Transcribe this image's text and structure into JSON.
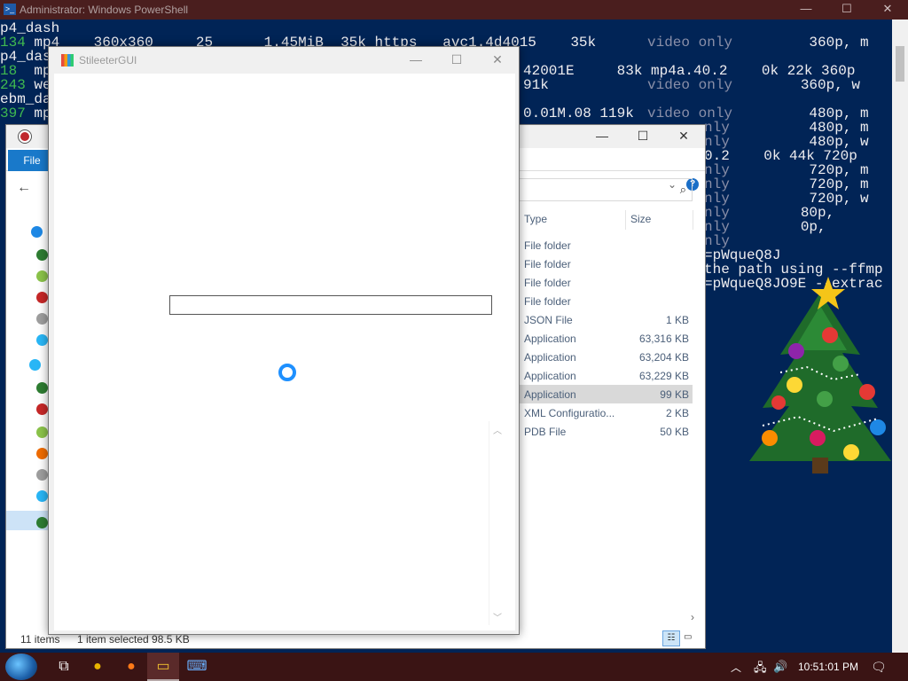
{
  "powershell": {
    "title": "Administrator: Windows PowerShell",
    "minimize": "—",
    "maximize": "☐",
    "close": "✕",
    "lines": [
      {
        "a": "p4_dash",
        "b": ""
      },
      {
        "a": "134",
        "b": " mp4    360x360     25      1.45MiB  35k https   avc1.4d4015    35k ",
        "c": "video only",
        "d": "         360p, m"
      },
      {
        "a": "p4_das",
        "b": ""
      },
      {
        "a": "18",
        "b": "  mp",
        "c2": "42001E     83k mp4a.40.2    0k 22k 360p"
      },
      {
        "a": "243",
        "b": " we",
        "c2": "91k ",
        "c": "video only",
        "d": "        360p, w"
      },
      {
        "a": "ebm_da",
        "b": ""
      },
      {
        "a": "397",
        "b": " mp",
        "c2": "0.01M.08 119k ",
        "c": "video only",
        "d": "         480p, m"
      },
      {
        "a": "",
        "b": "",
        "c2": "",
        "c": "nly",
        "d": "         480p, m"
      },
      {
        "a": "",
        "b": "",
        "c2": "",
        "c": "nly",
        "d": "         480p, w"
      },
      {
        "a": "",
        "b": "",
        "c2": "0.2    0k 44k 720p"
      },
      {
        "a": "",
        "b": "",
        "c2": "",
        "c": "nly",
        "d": "         720p, m"
      },
      {
        "a": "",
        "b": "",
        "c2": "",
        "c": "nly",
        "d": "         720p, m"
      },
      {
        "a": "",
        "b": "",
        "c2": "",
        "c": "nly",
        "d": "         720p, w"
      },
      {
        "a": "",
        "b": "",
        "c2": "",
        "c": "nly",
        "d": "        80p,"
      },
      {
        "a": "",
        "b": "",
        "c2": "",
        "c": "nly",
        "d": "        0p,"
      },
      {
        "a": "",
        "b": "",
        "c2": "",
        "c": "nly",
        "d": ""
      },
      {
        "a": "",
        "b": "",
        "c2": "=pWqueQ8J"
      },
      {
        "a": "",
        "b": "",
        "c2": "the path using --ffmp"
      },
      {
        "a": "",
        "b": "",
        "c2": "=pWqueQ8JO9E --extrac"
      }
    ]
  },
  "explorer": {
    "file_tab": "File",
    "back": "←",
    "search_icon": "⌕",
    "expand": "⌄",
    "help": "?",
    "minimize": "—",
    "maximize": "☐",
    "close": "✕",
    "columns": {
      "type": "Type",
      "size": "Size"
    },
    "rows": [
      {
        "type": "File folder",
        "size": ""
      },
      {
        "type": "File folder",
        "size": ""
      },
      {
        "type": "File folder",
        "size": ""
      },
      {
        "type": "File folder",
        "size": ""
      },
      {
        "type": "JSON File",
        "size": "1 KB"
      },
      {
        "type": "Application",
        "size": "63,316 KB"
      },
      {
        "type": "Application",
        "size": "63,204 KB"
      },
      {
        "type": "Application",
        "size": "63,229 KB"
      },
      {
        "type": "Application",
        "size": "99 KB",
        "selected": true
      },
      {
        "type": "XML Configuratio...",
        "size": "2 KB"
      },
      {
        "type": "PDB File",
        "size": "50 KB"
      }
    ],
    "status": {
      "items": "11 items",
      "selected": "1 item selected  98.5 KB"
    },
    "hscroll_arrow": "›",
    "view_details": "☷",
    "view_tiles": "▭"
  },
  "gui": {
    "title": "StileeterGUI",
    "minimize": "—",
    "maximize": "☐",
    "close": "✕",
    "input_value": "",
    "scroll_up": "︿",
    "scroll_down": "﹀"
  },
  "taskbar": {
    "taskview": "⧉",
    "chrome": "●",
    "firefox": "●",
    "explorer": "▭",
    "powershell": "⌨",
    "tray_chevron": "︿",
    "network": "🖧",
    "volume": "🔊",
    "clock": "10:51:01 PM",
    "action_center": "🗨"
  },
  "colors": {
    "ps_bg": "#012456",
    "accent": "#1979ca",
    "taskbar": "#3a1414"
  }
}
